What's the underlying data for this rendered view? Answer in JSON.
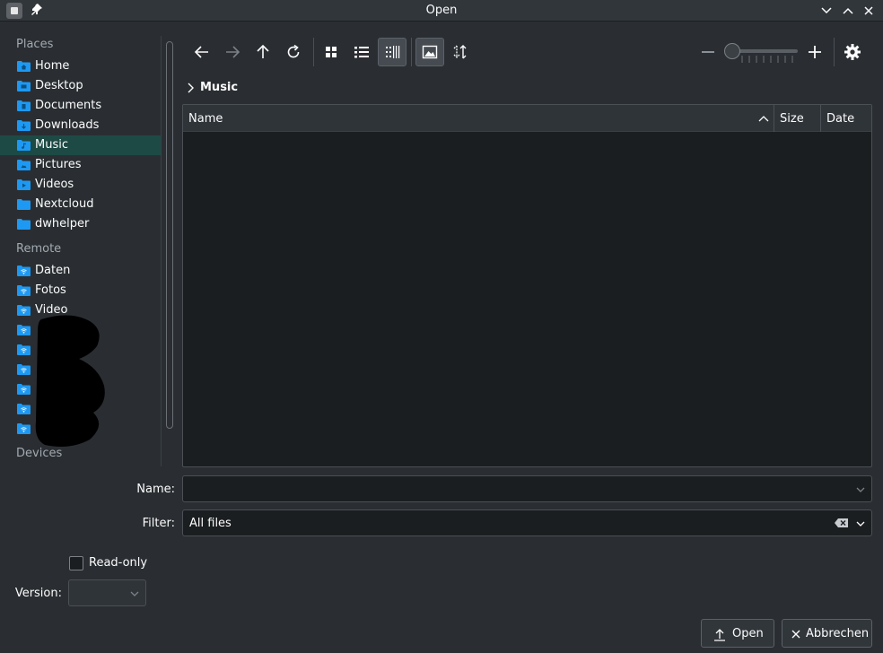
{
  "window": {
    "title": "Open"
  },
  "sidebar": {
    "places_label": "Places",
    "places": [
      {
        "label": "Home",
        "icon": "home-folder-icon"
      },
      {
        "label": "Desktop",
        "icon": "desktop-folder-icon"
      },
      {
        "label": "Documents",
        "icon": "documents-folder-icon"
      },
      {
        "label": "Downloads",
        "icon": "downloads-folder-icon"
      },
      {
        "label": "Music",
        "icon": "music-folder-icon",
        "active": true
      },
      {
        "label": "Pictures",
        "icon": "pictures-folder-icon"
      },
      {
        "label": "Videos",
        "icon": "videos-folder-icon"
      },
      {
        "label": "Nextcloud",
        "icon": "folder-icon"
      },
      {
        "label": "dwhelper",
        "icon": "folder-icon"
      }
    ],
    "remote_label": "Remote",
    "remote": [
      {
        "label": "Daten",
        "icon": "network-folder-icon"
      },
      {
        "label": "Fotos",
        "icon": "network-folder-icon"
      },
      {
        "label": "Video",
        "icon": "network-folder-icon"
      }
    ],
    "devices_label": "Devices"
  },
  "toolbar": {
    "back": "arrow-left-icon",
    "forward": "arrow-right-icon",
    "up": "arrow-up-icon",
    "reload": "reload-icon",
    "icons_view": "icons-view-icon",
    "compact_view": "compact-view-icon",
    "detail_view": "detail-view-icon",
    "preview": "image-preview-icon",
    "sort": "sort-icon",
    "zoom_out": "minus-icon",
    "zoom_in": "plus-icon",
    "settings": "gear-icon"
  },
  "breadcrumb": {
    "current": "Music"
  },
  "file_view": {
    "columns": [
      "Name",
      "Size",
      "Date"
    ]
  },
  "form": {
    "name_label": "Name:",
    "name_value": "",
    "filter_label": "Filter:",
    "filter_value": "All files",
    "readonly_label": "Read-only",
    "version_label": "Version:"
  },
  "buttons": {
    "open": "Open",
    "cancel": "Abbrechen"
  },
  "colors": {
    "background": "#2a2e32",
    "accent": "#1d4a45",
    "folder": "#1d99f3"
  }
}
